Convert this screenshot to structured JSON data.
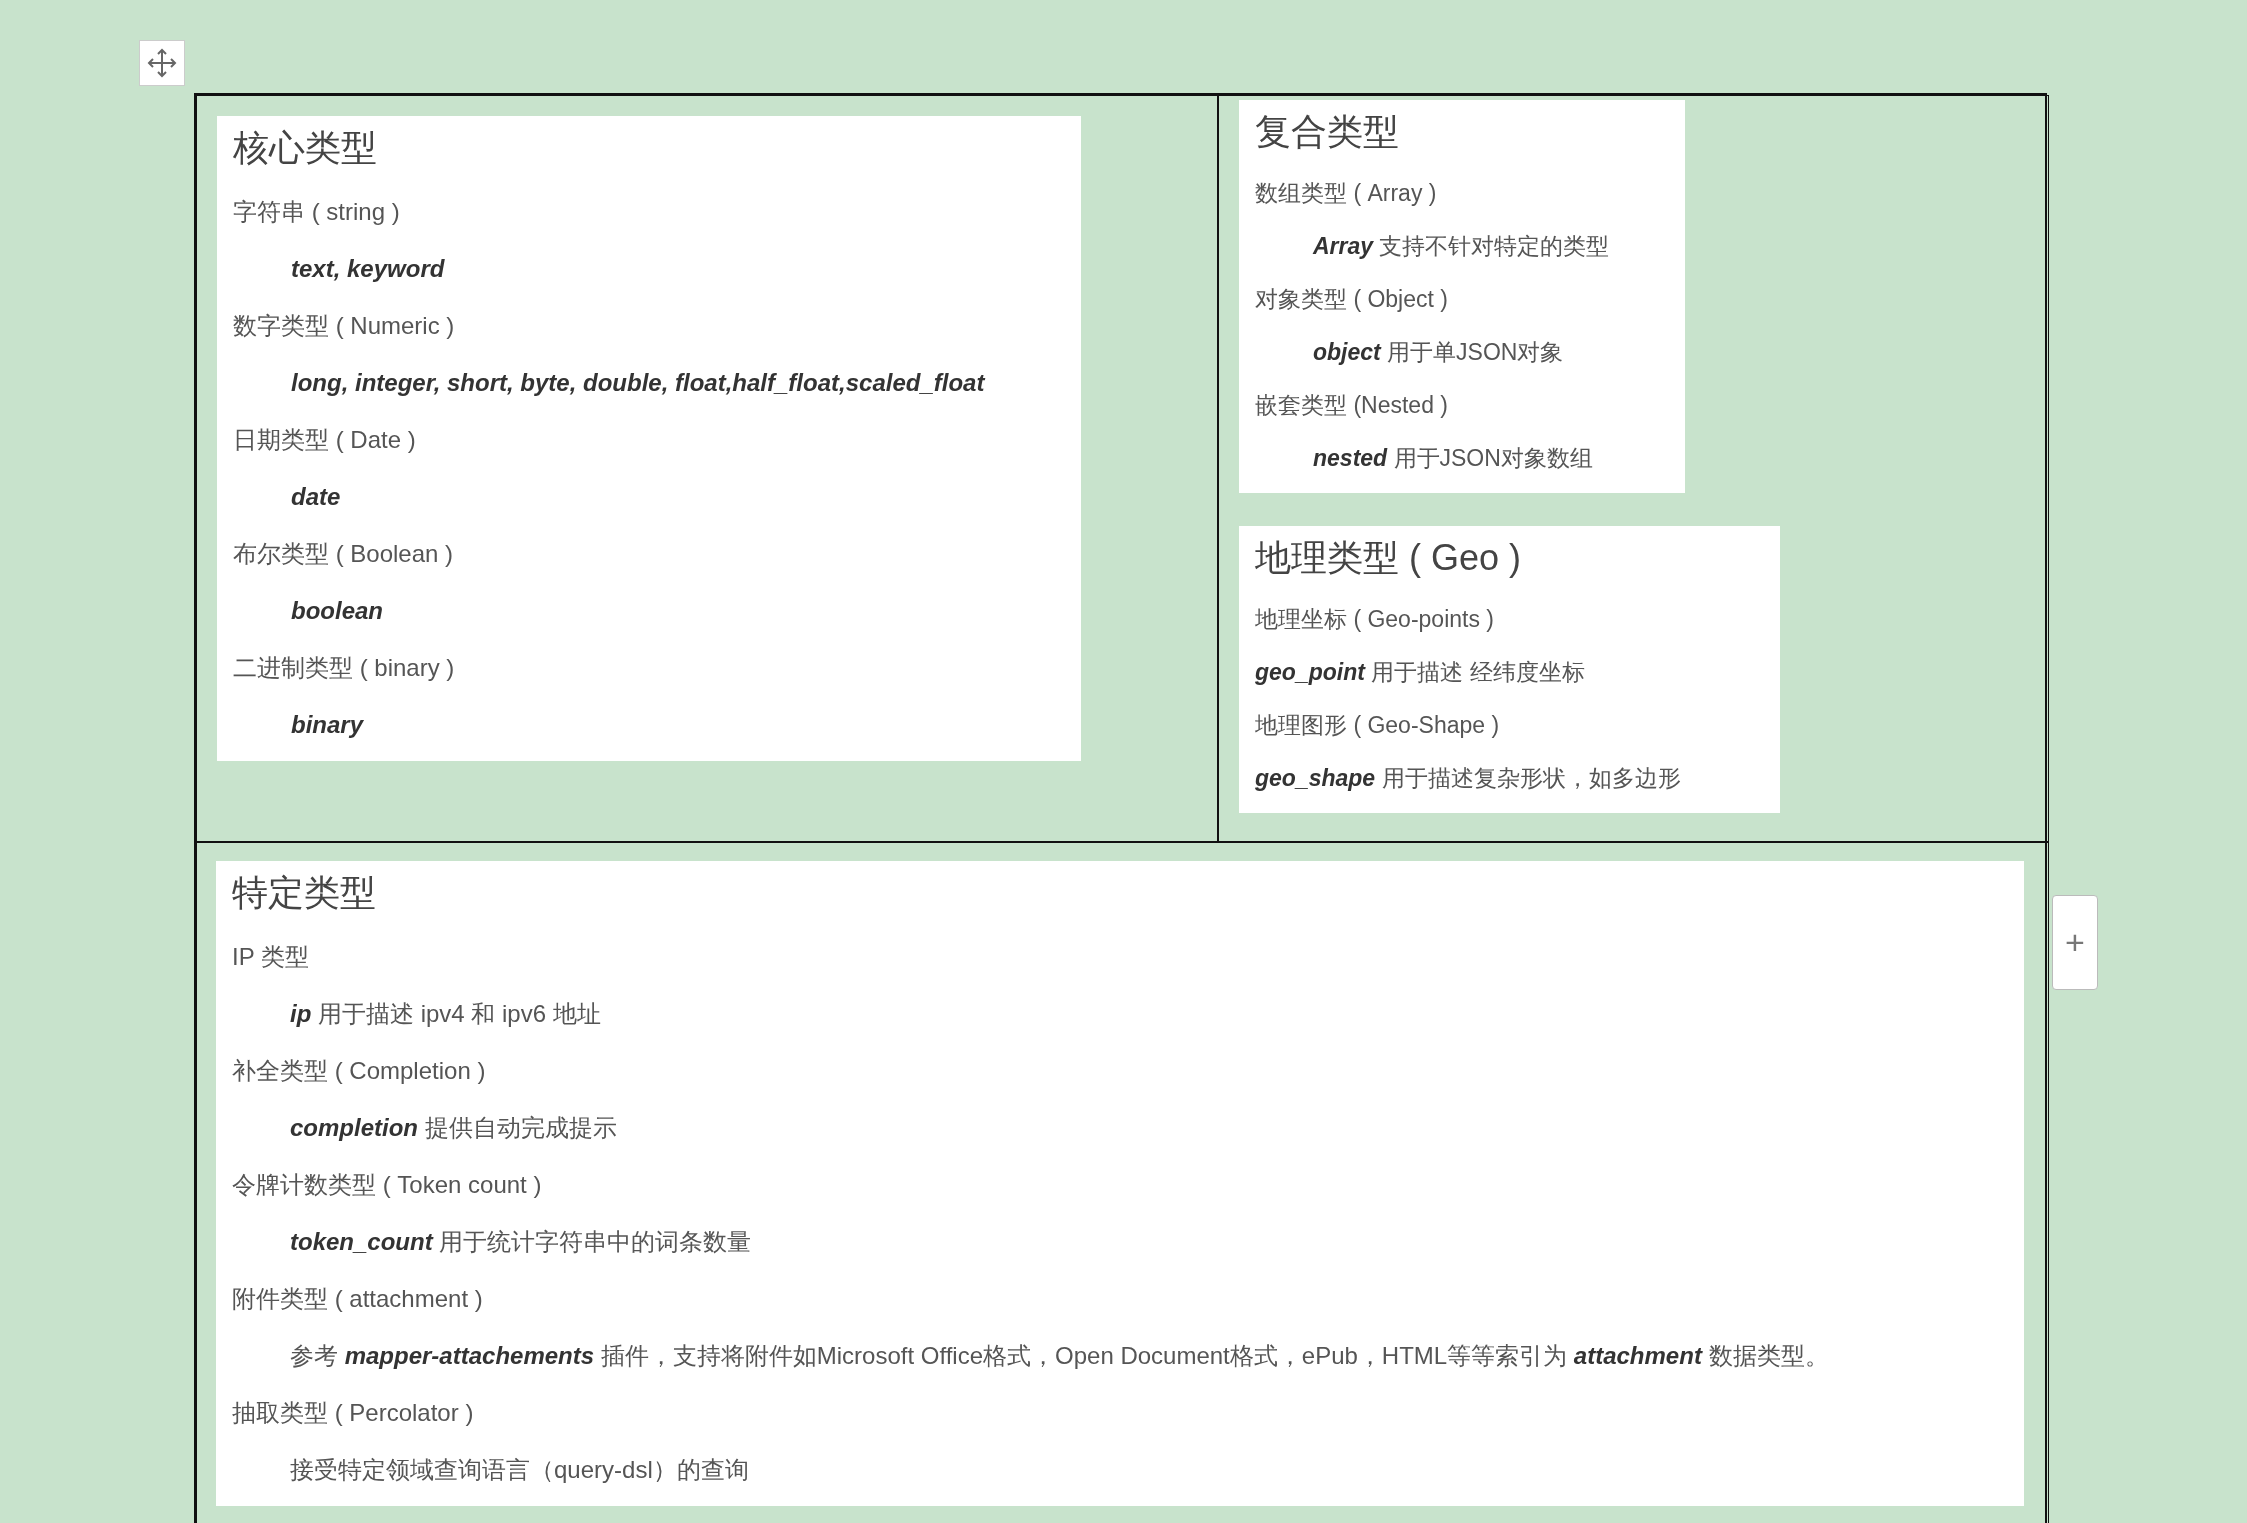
{
  "table": {
    "rows": [
      {
        "cells": [
          {
            "panels": [
              {
                "title": "核心类型",
                "lines": [
                  {
                    "kind": "entry",
                    "text": "字符串 ( string )"
                  },
                  {
                    "kind": "detail",
                    "text": "**text, keyword**"
                  },
                  {
                    "kind": "entry",
                    "text": "数字类型 ( Numeric )"
                  },
                  {
                    "kind": "detail",
                    "text": "**long, integer, short, byte, double, float,half_float,scaled_float**"
                  },
                  {
                    "kind": "entry",
                    "text": "日期类型 ( Date )"
                  },
                  {
                    "kind": "detail",
                    "text": "**date**"
                  },
                  {
                    "kind": "entry",
                    "text": "布尔类型 ( Boolean )"
                  },
                  {
                    "kind": "detail",
                    "text": "**boolean**"
                  },
                  {
                    "kind": "entry",
                    "text": "二进制类型 ( binary )"
                  },
                  {
                    "kind": "detail",
                    "text": "**binary**"
                  }
                ]
              }
            ]
          },
          {
            "panels": [
              {
                "title": "复合类型",
                "lines": [
                  {
                    "kind": "entry",
                    "text": "数组类型 ( Array )"
                  },
                  {
                    "kind": "detail",
                    "text": "**Array** 支持不针对特定的类型"
                  },
                  {
                    "kind": "entry",
                    "text": "对象类型 ( Object )"
                  },
                  {
                    "kind": "detail",
                    "text": "**object** 用于单JSON对象"
                  },
                  {
                    "kind": "entry",
                    "text": "嵌套类型 (Nested )"
                  },
                  {
                    "kind": "detail",
                    "text": "**nested** 用于JSON对象数组"
                  }
                ]
              },
              {
                "title": "地理类型 ( Geo )",
                "lines": [
                  {
                    "kind": "entry",
                    "text": "地理坐标 ( Geo-points )"
                  },
                  {
                    "kind": "flush",
                    "text": "**geo_point** 用于描述 经纬度坐标"
                  },
                  {
                    "kind": "entry",
                    "text": "地理图形 ( Geo-Shape )"
                  },
                  {
                    "kind": "flush",
                    "text": "**geo_shape** 用于描述复杂形状，如多边形"
                  }
                ]
              }
            ]
          }
        ]
      },
      {
        "cells": [
          {
            "panels": [
              {
                "title": "特定类型",
                "lines": [
                  {
                    "kind": "entry",
                    "text": "IP 类型"
                  },
                  {
                    "kind": "detail",
                    "text": "**ip** 用于描述 ipv4 和 ipv6 地址"
                  },
                  {
                    "kind": "entry",
                    "text": "补全类型 ( Completion  )"
                  },
                  {
                    "kind": "detail",
                    "text": "**completion** 提供自动完成提示"
                  },
                  {
                    "kind": "entry",
                    "text": "令牌计数类型 ( Token count )"
                  },
                  {
                    "kind": "detail",
                    "text": "**token_count** 用于统计字符串中的词条数量"
                  },
                  {
                    "kind": "entry",
                    "text": "附件类型 ( attachment )"
                  },
                  {
                    "kind": "detail",
                    "text": "参考 **mapper-attachements** 插件，支持将附件如Microsoft Office格式，Open Document格式，ePub，HTML等等索引为 **attachment** 数据类型。"
                  },
                  {
                    "kind": "entry",
                    "text": "抽取类型 ( Percolator )"
                  },
                  {
                    "kind": "detail",
                    "text": "接受特定领域查询语言（query-dsl）的查询"
                  }
                ]
              }
            ]
          }
        ]
      }
    ]
  },
  "add_button": "+"
}
